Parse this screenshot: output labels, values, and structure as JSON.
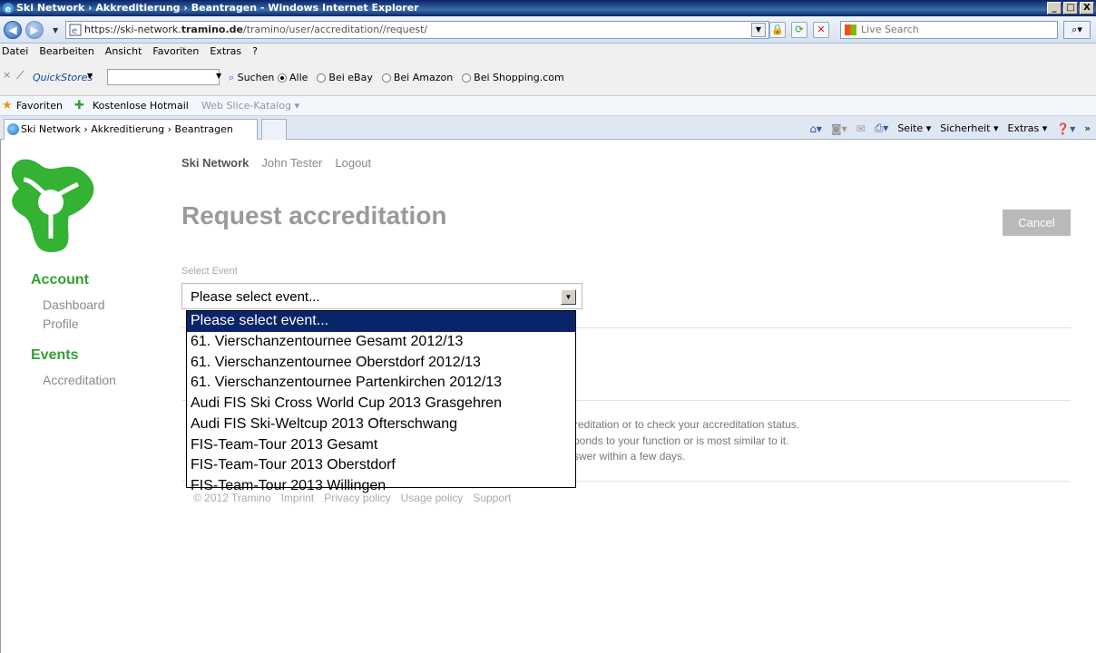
{
  "window": {
    "title": "Ski Network › Akkreditierung › Beantragen - Windows Internet Explorer",
    "min": "_",
    "max": "□",
    "close": "X"
  },
  "address": {
    "prefix": "https://ski-network.",
    "domain": "tramino.de",
    "path": "/tramino/user/accreditation//request/",
    "live_search_placeholder": "Live Search"
  },
  "menu": [
    "Datei",
    "Bearbeiten",
    "Ansicht",
    "Favoriten",
    "Extras",
    "?"
  ],
  "searchbar": {
    "quickstores_label": "QuickStores",
    "suchen": "Suchen",
    "radios": [
      {
        "label": "Alle",
        "checked": true
      },
      {
        "label": "Bei eBay",
        "checked": false
      },
      {
        "label": "Bei Amazon",
        "checked": false
      },
      {
        "label": "Bei Shopping.com",
        "checked": false
      }
    ]
  },
  "favorites": {
    "label": "Favoriten",
    "hotmail": "Kostenlose Hotmail",
    "slice": "Web Slice-Katalog ▾"
  },
  "tab": {
    "title": "Ski Network › Akkreditierung › Beantragen"
  },
  "commandbar": {
    "seite": "Seite ▾",
    "sicherheit": "Sicherheit ▾",
    "extras": "Extras ▾",
    "more": "»"
  },
  "page": {
    "brand": "Ski Network",
    "user": "John Tester",
    "logout": "Logout",
    "title": "Request accreditation",
    "cancel": "Cancel",
    "field_label": "Select Event",
    "selected_value": "Please select event...",
    "info_lines": [
      "ccreditation or to check your accreditation status.",
      "ponds to your function or is most similar to it.",
      "swer within a few days."
    ],
    "footer": [
      "© 2012 Tramino",
      "Imprint",
      "Privacy policy",
      "Usage policy",
      "Support"
    ]
  },
  "sidebar": {
    "account_heading": "Account",
    "account_links": [
      "Dashboard",
      "Profile"
    ],
    "events_heading": "Events",
    "events_links": [
      "Accreditation"
    ]
  },
  "dropdown_options": [
    "Please select event...",
    "61. Vierschanzentournee Gesamt 2012/13",
    "61. Vierschanzentournee Oberstdorf 2012/13",
    "61. Vierschanzentournee Partenkirchen 2012/13",
    "Audi FIS Ski Cross World Cup 2013 Grasgehren",
    "Audi FIS Ski-Weltcup 2013 Ofterschwang",
    "FIS-Team-Tour 2013 Gesamt",
    "FIS-Team-Tour 2013 Oberstdorf",
    "FIS-Team-Tour 2013 Willingen"
  ],
  "colors": {
    "accent_green": "#35a035",
    "selected_blue": "#0a246a",
    "title_gray": "#9a9a9a"
  }
}
